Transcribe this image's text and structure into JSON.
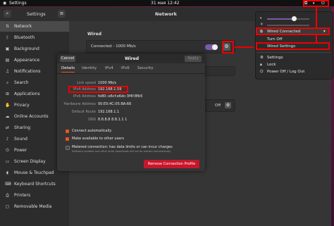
{
  "topbar": {
    "activities_icon": "ubuntu-menu",
    "app": "Settings",
    "datetime": "31 мая  12:42"
  },
  "window": {
    "title": "Network",
    "header_title": "Settings",
    "search_icon": "search",
    "menu_icon": "hamburger"
  },
  "sidebar": {
    "items": [
      {
        "icon": "network",
        "label": "Network"
      },
      {
        "icon": "bluetooth",
        "label": "Bluetooth"
      },
      {
        "icon": "background",
        "label": "Background"
      },
      {
        "icon": "appearance",
        "label": "Appearance"
      },
      {
        "icon": "notifications",
        "label": "Notifications"
      },
      {
        "icon": "search",
        "label": "Search"
      },
      {
        "icon": "applications",
        "label": "Applications"
      },
      {
        "icon": "privacy",
        "label": "Privacy"
      },
      {
        "icon": "online-accounts",
        "label": "Online Accounts"
      },
      {
        "icon": "sharing",
        "label": "Sharing"
      },
      {
        "icon": "sound",
        "label": "Sound"
      },
      {
        "icon": "power",
        "label": "Power"
      },
      {
        "icon": "display",
        "label": "Screen Display"
      },
      {
        "icon": "mouse",
        "label": "Mouse & Touchpad"
      },
      {
        "icon": "keyboard",
        "label": "Keyboard Shortcuts"
      },
      {
        "icon": "printers",
        "label": "Printers"
      },
      {
        "icon": "removable",
        "label": "Removable Media"
      }
    ]
  },
  "content": {
    "wired_heading": "Wired",
    "connection_status": "Connected - 1000 Mb/s",
    "toggle_on": true,
    "proxy_value": "Off"
  },
  "dialog": {
    "cancel": "Cancel",
    "title": "Wired",
    "apply": "Apply",
    "tabs": [
      "Details",
      "Identity",
      "IPv4",
      "IPv6",
      "Security"
    ],
    "active_tab": "Details",
    "details": [
      {
        "label": "Link speed",
        "value": "1000 Mb/s"
      },
      {
        "label": "IPv4 Address",
        "value": "192.168.1.59"
      },
      {
        "label": "IPv6 Address",
        "value": "fe80::e6cf:e6dc:3f4f:8fb5"
      },
      {
        "label": "Hardware Address",
        "value": "00:E0:4C:05:BA:66"
      },
      {
        "label": "Default Route",
        "value": "192.168.1.1"
      },
      {
        "label": "DNS",
        "value": "8.8.8.8 8.8.1.1 1"
      }
    ],
    "connect_auto": "Connect automatically",
    "available_all": "Make available to other users",
    "metered": "Metered connection: has data limits or can incur charges",
    "metered_sub": "Software updates and other large downloads will not be started automatically.",
    "remove": "Remove Connection Profile"
  },
  "tray": {
    "volume_level": 0.62,
    "brightness_level": 0.55,
    "wired_connected": "Wired Connected",
    "turn_off": "Turn Off",
    "wired_settings": "Wired Settings",
    "settings": "Settings",
    "lock": "Lock",
    "power_off": "Power Off / Log Out"
  },
  "colors": {
    "accent": "#e95420",
    "highlight_red": "#ee0000",
    "active_item": "#4a4a4a"
  }
}
